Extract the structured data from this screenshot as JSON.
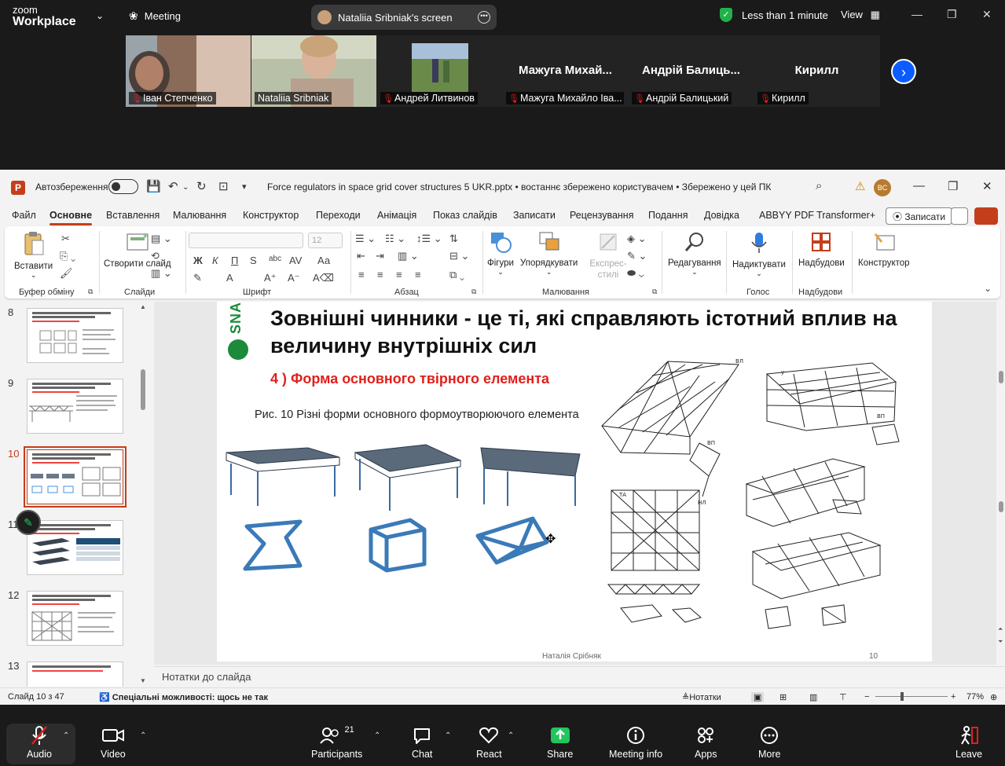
{
  "zoom": {
    "logo_line1": "zoom",
    "logo_line2": "Workplace",
    "meeting_label": "Meeting",
    "share_pill": "Nataliia Sribniak's screen",
    "security_text": "Less than 1 minute",
    "view_label": "View",
    "participants": [
      {
        "name": "Іван Степченко",
        "video": true,
        "muted": true
      },
      {
        "name": "Nataliia Sribniak",
        "video": true,
        "muted": false,
        "active": true
      },
      {
        "name": "Андрей Литвинов",
        "video": true,
        "muted": true
      },
      {
        "name": "Мажуга Михайло Іва...",
        "display": "Мажуга Михай...",
        "video": false,
        "muted": true
      },
      {
        "name": "Андрій Балицький",
        "display": "Андрій Балиць...",
        "video": false,
        "muted": true
      },
      {
        "name": "Кирилл",
        "display": "Кирилл",
        "video": false,
        "muted": true
      }
    ],
    "toolbar": {
      "audio": "Audio",
      "video": "Video",
      "participants": "Participants",
      "participants_count": "21",
      "chat": "Chat",
      "react": "React",
      "share": "Share",
      "meeting_info": "Meeting info",
      "apps": "Apps",
      "more": "More",
      "leave": "Leave"
    },
    "accent": "#0b5cff",
    "share_color": "#22c55e",
    "leave_color": "#e02020"
  },
  "ppt": {
    "autosave": "Автозбереження",
    "doc_title": "Force regulators in space grid cover structures 5 UKR.pptx  •  востаннє збережено користувачем  •  Збережено у цей ПК",
    "user_initials": "BC",
    "menu": [
      "Файл",
      "Основне",
      "Вставлення",
      "Малювання",
      "Конструктор",
      "Переходи",
      "Анімація",
      "Показ слайдів",
      "Записати",
      "Рецензування",
      "Подання",
      "Довідка",
      "ABBYY PDF Transformer+"
    ],
    "menu_selected": "Основне",
    "record_button": "Записати",
    "ribbon": {
      "paste": "Вставити",
      "clipboard_group": "Буфер обміну",
      "new_slide": "Створити слайд",
      "slides_group": "Слайди",
      "font_size": "12",
      "font_group": "Шрифт",
      "paragraph_group": "Абзац",
      "shapes": "Фігури",
      "arrange": "Упорядкувати",
      "quick_styles": "Експрес-стилі",
      "drawing_group": "Малювання",
      "editing": "Редагування",
      "dictate": "Надиктувати",
      "voice_group": "Голос",
      "addins": "Надбудови",
      "addins_group": "Надбудови",
      "designer": "Конструктор"
    },
    "thumbnails": [
      {
        "num": "8",
        "selected": false
      },
      {
        "num": "9",
        "selected": false
      },
      {
        "num": "10",
        "selected": true
      },
      {
        "num": "11",
        "selected": false
      },
      {
        "num": "12",
        "selected": false
      },
      {
        "num": "13",
        "selected": false
      }
    ],
    "slide": {
      "logo": "SNA",
      "title": "Зовнішні чинники - це ті, які справляють істотний вплив на величину внутрішніх сил",
      "subtitle": "4 ) Форма основного твірного елемента",
      "caption": "Рис. 10 Різні форми основного формоутворюючого елемента",
      "footer": "Наталія Срібняк",
      "number": "10"
    },
    "notes_placeholder": "Нотатки до слайда",
    "status": {
      "slide_info": "Слайд 10 з 47",
      "accessibility": "Спеціальні можливості: щось не так",
      "notes_btn": "Нотатки",
      "zoom": "77%"
    }
  }
}
